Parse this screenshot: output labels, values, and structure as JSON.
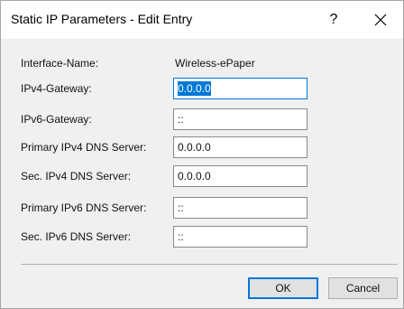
{
  "window": {
    "title": "Static IP Parameters - Edit Entry",
    "help_label": "?",
    "close_icon": "close-icon"
  },
  "form": {
    "interface_name": {
      "label": "Interface-Name:",
      "value": "Wireless-ePaper"
    },
    "ipv4_gateway": {
      "label": "IPv4-Gateway:",
      "value": "0.0.0.0"
    },
    "ipv6_gateway": {
      "label": "IPv6-Gateway:",
      "value": "::"
    },
    "primary_ipv4_dns": {
      "label": "Primary IPv4 DNS Server:",
      "value": "0.0.0.0"
    },
    "sec_ipv4_dns": {
      "label": "Sec. IPv4 DNS Server:",
      "value": "0.0.0.0"
    },
    "primary_ipv6_dns": {
      "label": "Primary IPv6 DNS Server:",
      "value": "::"
    },
    "sec_ipv6_dns": {
      "label": "Sec. IPv6 DNS Server:",
      "value": "::"
    }
  },
  "buttons": {
    "ok_label": "OK",
    "cancel_label": "Cancel"
  },
  "colors": {
    "accent": "#0078d7",
    "dialog_background": "#f0f0f0",
    "titlebar_background": "#ffffff"
  }
}
